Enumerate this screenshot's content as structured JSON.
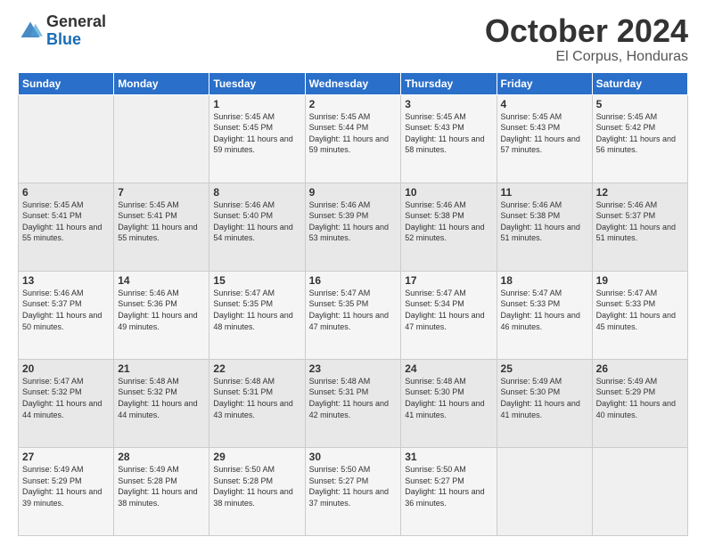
{
  "logo": {
    "general": "General",
    "blue": "Blue"
  },
  "header": {
    "month": "October 2024",
    "location": "El Corpus, Honduras"
  },
  "weekdays": [
    "Sunday",
    "Monday",
    "Tuesday",
    "Wednesday",
    "Thursday",
    "Friday",
    "Saturday"
  ],
  "weeks": [
    [
      {
        "day": "",
        "sunrise": "",
        "sunset": "",
        "daylight": ""
      },
      {
        "day": "",
        "sunrise": "",
        "sunset": "",
        "daylight": ""
      },
      {
        "day": "1",
        "sunrise": "Sunrise: 5:45 AM",
        "sunset": "Sunset: 5:45 PM",
        "daylight": "Daylight: 11 hours and 59 minutes."
      },
      {
        "day": "2",
        "sunrise": "Sunrise: 5:45 AM",
        "sunset": "Sunset: 5:44 PM",
        "daylight": "Daylight: 11 hours and 59 minutes."
      },
      {
        "day": "3",
        "sunrise": "Sunrise: 5:45 AM",
        "sunset": "Sunset: 5:43 PM",
        "daylight": "Daylight: 11 hours and 58 minutes."
      },
      {
        "day": "4",
        "sunrise": "Sunrise: 5:45 AM",
        "sunset": "Sunset: 5:43 PM",
        "daylight": "Daylight: 11 hours and 57 minutes."
      },
      {
        "day": "5",
        "sunrise": "Sunrise: 5:45 AM",
        "sunset": "Sunset: 5:42 PM",
        "daylight": "Daylight: 11 hours and 56 minutes."
      }
    ],
    [
      {
        "day": "6",
        "sunrise": "Sunrise: 5:45 AM",
        "sunset": "Sunset: 5:41 PM",
        "daylight": "Daylight: 11 hours and 55 minutes."
      },
      {
        "day": "7",
        "sunrise": "Sunrise: 5:45 AM",
        "sunset": "Sunset: 5:41 PM",
        "daylight": "Daylight: 11 hours and 55 minutes."
      },
      {
        "day": "8",
        "sunrise": "Sunrise: 5:46 AM",
        "sunset": "Sunset: 5:40 PM",
        "daylight": "Daylight: 11 hours and 54 minutes."
      },
      {
        "day": "9",
        "sunrise": "Sunrise: 5:46 AM",
        "sunset": "Sunset: 5:39 PM",
        "daylight": "Daylight: 11 hours and 53 minutes."
      },
      {
        "day": "10",
        "sunrise": "Sunrise: 5:46 AM",
        "sunset": "Sunset: 5:38 PM",
        "daylight": "Daylight: 11 hours and 52 minutes."
      },
      {
        "day": "11",
        "sunrise": "Sunrise: 5:46 AM",
        "sunset": "Sunset: 5:38 PM",
        "daylight": "Daylight: 11 hours and 51 minutes."
      },
      {
        "day": "12",
        "sunrise": "Sunrise: 5:46 AM",
        "sunset": "Sunset: 5:37 PM",
        "daylight": "Daylight: 11 hours and 51 minutes."
      }
    ],
    [
      {
        "day": "13",
        "sunrise": "Sunrise: 5:46 AM",
        "sunset": "Sunset: 5:37 PM",
        "daylight": "Daylight: 11 hours and 50 minutes."
      },
      {
        "day": "14",
        "sunrise": "Sunrise: 5:46 AM",
        "sunset": "Sunset: 5:36 PM",
        "daylight": "Daylight: 11 hours and 49 minutes."
      },
      {
        "day": "15",
        "sunrise": "Sunrise: 5:47 AM",
        "sunset": "Sunset: 5:35 PM",
        "daylight": "Daylight: 11 hours and 48 minutes."
      },
      {
        "day": "16",
        "sunrise": "Sunrise: 5:47 AM",
        "sunset": "Sunset: 5:35 PM",
        "daylight": "Daylight: 11 hours and 47 minutes."
      },
      {
        "day": "17",
        "sunrise": "Sunrise: 5:47 AM",
        "sunset": "Sunset: 5:34 PM",
        "daylight": "Daylight: 11 hours and 47 minutes."
      },
      {
        "day": "18",
        "sunrise": "Sunrise: 5:47 AM",
        "sunset": "Sunset: 5:33 PM",
        "daylight": "Daylight: 11 hours and 46 minutes."
      },
      {
        "day": "19",
        "sunrise": "Sunrise: 5:47 AM",
        "sunset": "Sunset: 5:33 PM",
        "daylight": "Daylight: 11 hours and 45 minutes."
      }
    ],
    [
      {
        "day": "20",
        "sunrise": "Sunrise: 5:47 AM",
        "sunset": "Sunset: 5:32 PM",
        "daylight": "Daylight: 11 hours and 44 minutes."
      },
      {
        "day": "21",
        "sunrise": "Sunrise: 5:48 AM",
        "sunset": "Sunset: 5:32 PM",
        "daylight": "Daylight: 11 hours and 44 minutes."
      },
      {
        "day": "22",
        "sunrise": "Sunrise: 5:48 AM",
        "sunset": "Sunset: 5:31 PM",
        "daylight": "Daylight: 11 hours and 43 minutes."
      },
      {
        "day": "23",
        "sunrise": "Sunrise: 5:48 AM",
        "sunset": "Sunset: 5:31 PM",
        "daylight": "Daylight: 11 hours and 42 minutes."
      },
      {
        "day": "24",
        "sunrise": "Sunrise: 5:48 AM",
        "sunset": "Sunset: 5:30 PM",
        "daylight": "Daylight: 11 hours and 41 minutes."
      },
      {
        "day": "25",
        "sunrise": "Sunrise: 5:49 AM",
        "sunset": "Sunset: 5:30 PM",
        "daylight": "Daylight: 11 hours and 41 minutes."
      },
      {
        "day": "26",
        "sunrise": "Sunrise: 5:49 AM",
        "sunset": "Sunset: 5:29 PM",
        "daylight": "Daylight: 11 hours and 40 minutes."
      }
    ],
    [
      {
        "day": "27",
        "sunrise": "Sunrise: 5:49 AM",
        "sunset": "Sunset: 5:29 PM",
        "daylight": "Daylight: 11 hours and 39 minutes."
      },
      {
        "day": "28",
        "sunrise": "Sunrise: 5:49 AM",
        "sunset": "Sunset: 5:28 PM",
        "daylight": "Daylight: 11 hours and 38 minutes."
      },
      {
        "day": "29",
        "sunrise": "Sunrise: 5:50 AM",
        "sunset": "Sunset: 5:28 PM",
        "daylight": "Daylight: 11 hours and 38 minutes."
      },
      {
        "day": "30",
        "sunrise": "Sunrise: 5:50 AM",
        "sunset": "Sunset: 5:27 PM",
        "daylight": "Daylight: 11 hours and 37 minutes."
      },
      {
        "day": "31",
        "sunrise": "Sunrise: 5:50 AM",
        "sunset": "Sunset: 5:27 PM",
        "daylight": "Daylight: 11 hours and 36 minutes."
      },
      {
        "day": "",
        "sunrise": "",
        "sunset": "",
        "daylight": ""
      },
      {
        "day": "",
        "sunrise": "",
        "sunset": "",
        "daylight": ""
      }
    ]
  ]
}
